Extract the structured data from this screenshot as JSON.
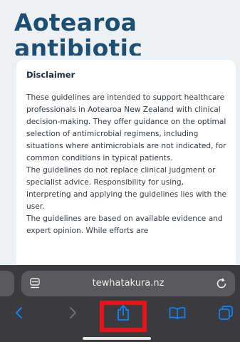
{
  "page": {
    "title_line1": "Aotearoa",
    "title_line2": "antibiotic"
  },
  "disclaimer": {
    "heading": "Disclaimer",
    "paragraph1": "These guidelines are intended to support healthcare professionals in Aotearoa New Zealand with clinical decision-making. They offer guidance on the optimal selection of antimicrobial regimens, including situations where antimicrobials are not indicated, for common conditions in typical patients.",
    "paragraph2": "The guidelines do not replace clinical judgment or specialist advice. Responsibility for using, interpreting and applying the guidelines lies with the user.",
    "paragraph3": "The guidelines are based on available evidence and expert opinion. While efforts are"
  },
  "browser": {
    "url": "tewhatakura.nz",
    "toolbar": {
      "icons": [
        "back-icon",
        "forward-icon",
        "share-icon",
        "bookmarks-icon",
        "tabs-icon"
      ]
    },
    "colors": {
      "chrome_bg": "#3b3b3d",
      "bar_bg": "#5a5a5d",
      "accent": "#0a84ff",
      "highlight": "#e3151b",
      "title": "#1d4e73"
    }
  }
}
